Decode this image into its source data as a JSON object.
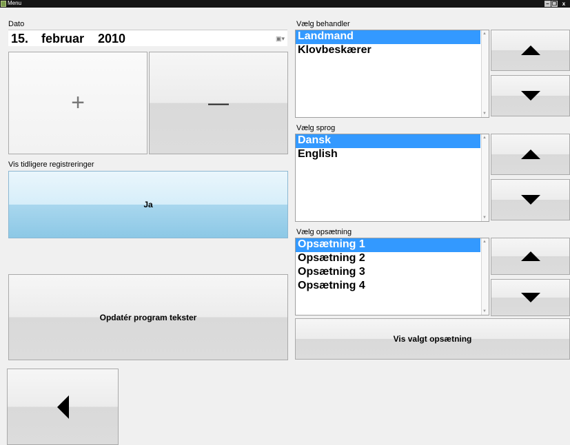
{
  "window": {
    "title": "Menu",
    "controls": {
      "minimize": "–",
      "maximize": "❐",
      "close": "x"
    }
  },
  "date": {
    "label": "Dato",
    "day": "15.",
    "month": "februar",
    "year": "2010",
    "dropdown_icon": "calendar-dropdown-icon"
  },
  "plus_button": {
    "symbol": "+"
  },
  "minus_button": {
    "symbol": "—"
  },
  "previous_registrations": {
    "label": "Vis tidligere registreringer",
    "button_label": "Ja"
  },
  "update_button_label": "Opdatér program tekster",
  "treater": {
    "label": "Vælg behandler",
    "items": [
      "Landmand",
      "Klovbeskærer"
    ],
    "selected_index": 0
  },
  "language": {
    "label": "Vælg sprog",
    "items": [
      "Dansk",
      "English"
    ],
    "selected_index": 0
  },
  "setup": {
    "label": "Vælg opsætning",
    "items": [
      "Opsætning 1",
      "Opsætning 2",
      "Opsætning 3",
      "Opsætning 4"
    ],
    "selected_index": 0,
    "show_button_label": "Vis valgt opsætning"
  },
  "icons": {
    "up": "arrow-up-icon",
    "down": "arrow-down-icon",
    "back": "arrow-left-icon"
  },
  "colors": {
    "selection": "#3399ff",
    "blue_button": "#8cc8e6",
    "background": "#f0f0f0"
  }
}
